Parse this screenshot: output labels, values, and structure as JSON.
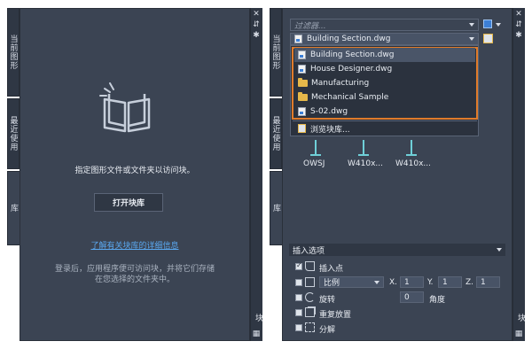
{
  "left_panel": {
    "tabs": [
      "当前图形",
      "最近使用",
      "库"
    ],
    "message": "指定图形文件或文件夹以访问块。",
    "open_button": "打开块库",
    "learn_link": "了解有关块库的详细信息",
    "info_line1": "登录后，应用程序便可访问块，并将它们存储",
    "info_line2": "在您选择的文件夹中。",
    "side_label": "块"
  },
  "right_panel": {
    "tabs": [
      "当前图形",
      "最近使用",
      "库"
    ],
    "filter_placeholder": "过滤器...",
    "selected_file": "Building Section.dwg",
    "dropdown_items": [
      {
        "label": "Building Section.dwg",
        "type": "dwg"
      },
      {
        "label": "House Designer.dwg",
        "type": "dwg"
      },
      {
        "label": "Manufacturing",
        "type": "folder"
      },
      {
        "label": "Mechanical Sample",
        "type": "folder"
      },
      {
        "label": "S-02.dwg",
        "type": "dwg"
      }
    ],
    "browse_label": "浏览块库...",
    "blocks": [
      "OWSJ",
      "W410x...",
      "W410x..."
    ],
    "insert_options_title": "插入选项",
    "insertion_point": "插入点",
    "scale_mode": "比例",
    "x_label": "X.",
    "x_value": "1",
    "y_label": "Y.",
    "y_value": "1",
    "z_label": "Z.",
    "z_value": "1",
    "rotate_label": "旋转",
    "rotate_value": "0",
    "angle_label": "角度",
    "repeat_label": "重复放置",
    "explode_label": "分解",
    "side_label": "块"
  },
  "colors": {
    "panel_bg": "#3b4453",
    "tab_bg": "#2f3744",
    "highlight": "#e07b2a",
    "link": "#5aa8f0",
    "field_bg": "#485366"
  }
}
